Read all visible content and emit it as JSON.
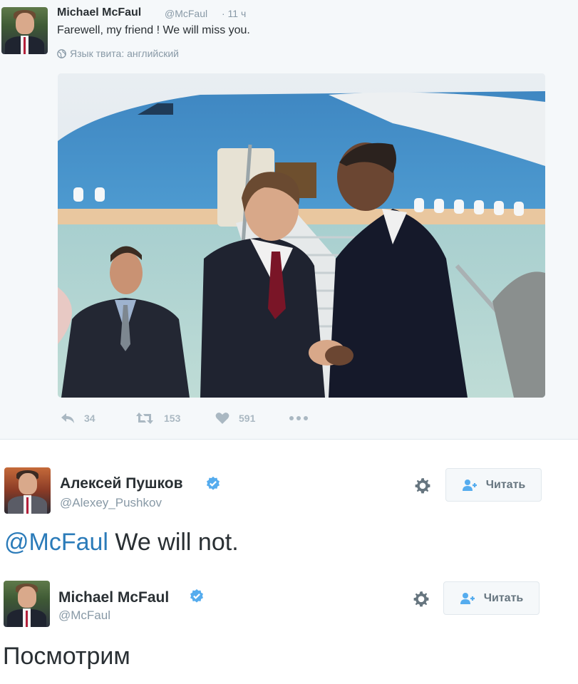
{
  "quoted_tweet": {
    "author_name": "Michael McFaul",
    "author_handle": "@McFaul",
    "time": "· 11 ч",
    "text": "Farewell, my friend !  We will miss you.",
    "language_note": "Язык твита: английский",
    "actions": {
      "reply_count": "34",
      "retweet_count": "153",
      "like_count": "591"
    }
  },
  "reply_1": {
    "author_name": "Алексей Пушков",
    "author_handle": "@Alexey_Pushkov",
    "follow_label": "Читать",
    "mention": "@McFaul",
    "text": " We will not."
  },
  "reply_2": {
    "author_name": "Michael McFaul",
    "author_handle": "@McFaul",
    "follow_label": "Читать",
    "text": "Посмотрим"
  },
  "colors": {
    "link": "#2b7bb9",
    "verified": "#55acee",
    "muted": "#8899a6",
    "action_icon": "#aab8c2"
  }
}
